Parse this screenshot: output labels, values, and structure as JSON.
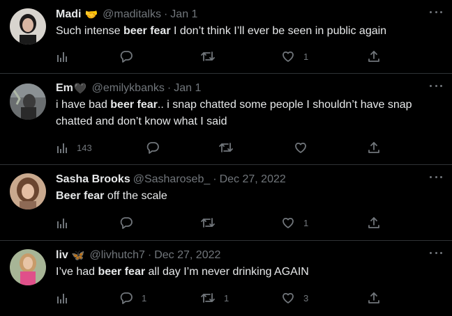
{
  "colors": {
    "background": "#000000",
    "text_primary": "#e7e9ea",
    "text_secondary": "#71767b",
    "divider": "#2f3336"
  },
  "tweets": [
    {
      "name": "Madi",
      "name_emoji": "🤝",
      "handle": "@maditalks",
      "dot": "·",
      "date": "Jan 1",
      "text_before": "Such intense ",
      "text_bold": "beer fear",
      "text_after": " I don’t think I’ll ever be seen in public again",
      "views": "",
      "replies": "",
      "retweets": "",
      "likes": "1"
    },
    {
      "name": "Em",
      "name_emoji": "🖤",
      "handle": "@emilykbanks",
      "dot": "·",
      "date": "Jan 1",
      "text_before": "i have bad ",
      "text_bold": "beer fear",
      "text_after": ".. i snap chatted some people I shouldn’t have snap chatted and don’t know what I said",
      "views": "143",
      "replies": "",
      "retweets": "",
      "likes": ""
    },
    {
      "name": "Sasha Brooks",
      "name_emoji": "",
      "handle": "@Sasharoseb_",
      "dot": "·",
      "date": "Dec 27, 2022",
      "text_before": "",
      "text_bold": "Beer fear",
      "text_after": " off the scale",
      "views": "",
      "replies": "",
      "retweets": "",
      "likes": "1"
    },
    {
      "name": "liv",
      "name_emoji": "🦋",
      "handle": "@livhutch7",
      "dot": "·",
      "date": "Dec 27, 2022",
      "text_before": "I’ve had ",
      "text_bold": "beer fear",
      "text_after": " all day I’m never drinking AGAIN",
      "views": "",
      "replies": "1",
      "retweets": "1",
      "likes": "3"
    }
  ],
  "icons": {
    "views": "bar-chart-icon",
    "reply": "speech-bubble-icon",
    "retweet": "retweet-arrows-icon",
    "like": "heart-icon",
    "share": "share-upload-icon",
    "more": "more-dots-icon"
  }
}
